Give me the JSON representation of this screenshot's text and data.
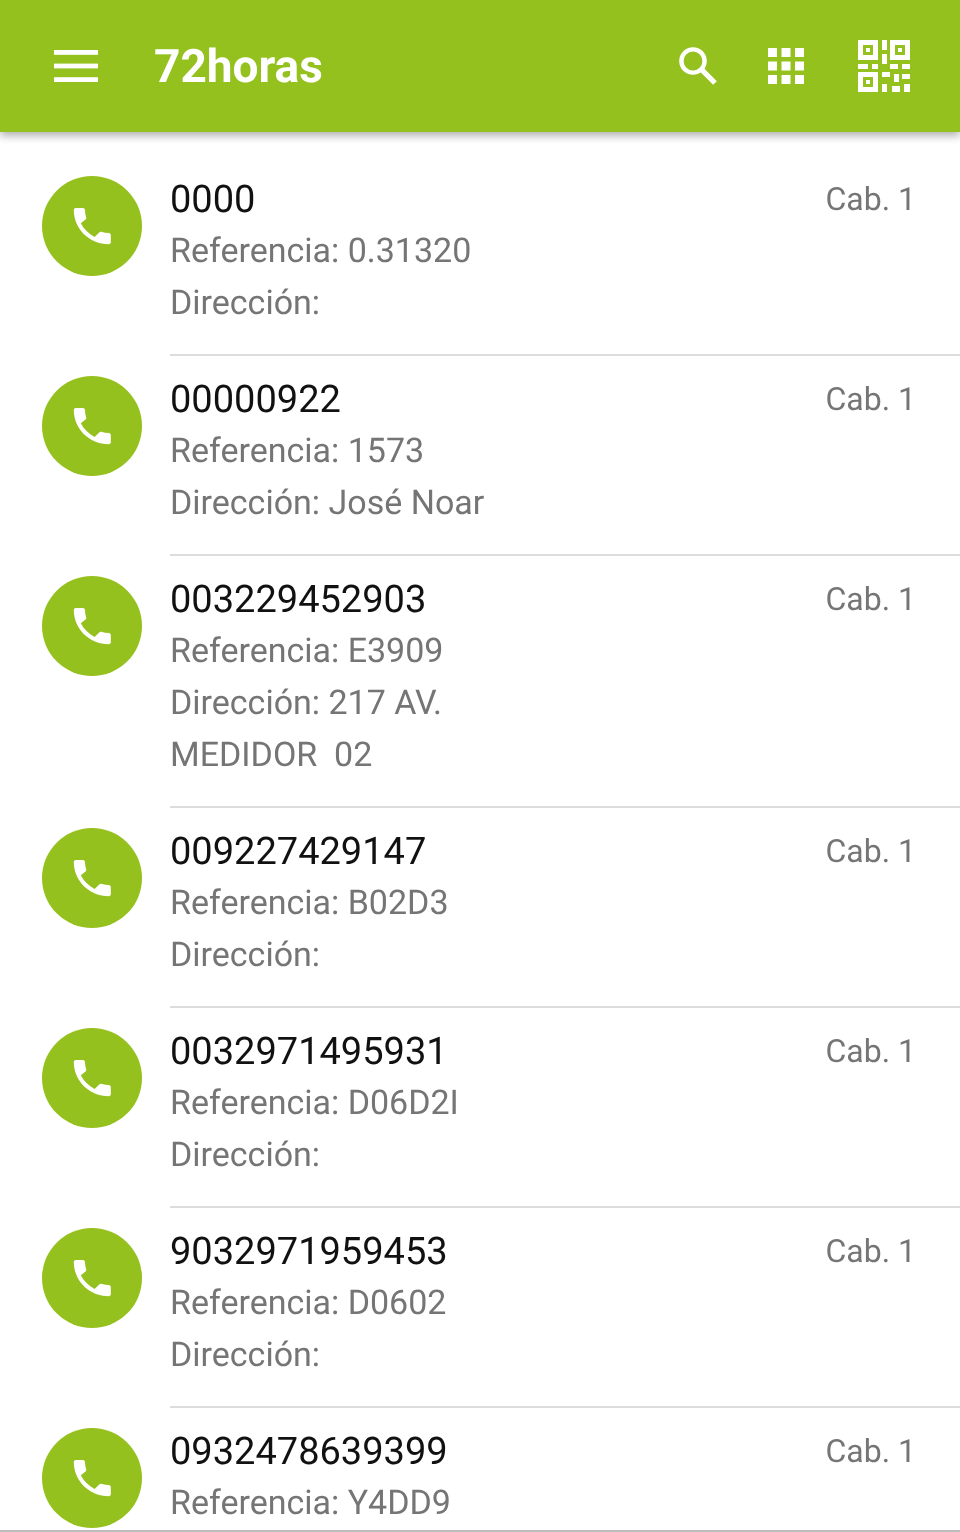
{
  "app_bar": {
    "title": "72horas"
  },
  "contacts": [
    {
      "number": "0000",
      "reference": "Referencia: 0.31320",
      "address": "Dirección:",
      "cabin": "Cab. 1"
    },
    {
      "number": "00000922",
      "reference": "Referencia: 1573",
      "address": "Dirección: José Noar",
      "cabin": "Cab. 1"
    },
    {
      "number": "003229452903",
      "reference": "Referencia: E3909",
      "address": "Dirección: 217 AV.\nMEDIDOR  02",
      "cabin": "Cab. 1"
    },
    {
      "number": "009227429147",
      "reference": "Referencia: B02D3",
      "address": "Dirección:",
      "cabin": "Cab. 1"
    },
    {
      "number": "0032971495931",
      "reference": "Referencia: D06D2I",
      "address": "Dirección:",
      "cabin": "Cab. 1"
    },
    {
      "number": "9032971959453",
      "reference": "Referencia: D0602",
      "address": "Dirección:",
      "cabin": "Cab. 1"
    },
    {
      "number": "0932478639399",
      "reference": "Referencia: Y4DD9",
      "cabin": "Cab. 1"
    }
  ]
}
